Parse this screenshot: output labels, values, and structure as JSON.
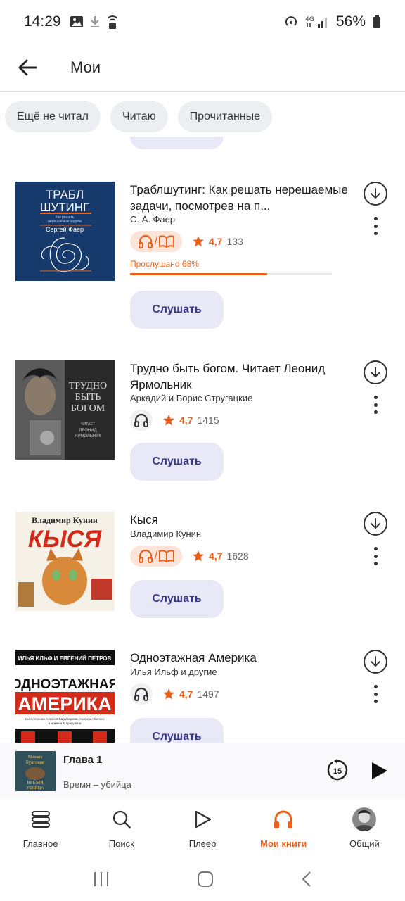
{
  "status_bar": {
    "time": "14:29",
    "battery": "56%"
  },
  "header": {
    "title": "Мои"
  },
  "filters": [
    "Ещё не читал",
    "Читаю",
    "Прочитанные"
  ],
  "listen_label": "Слушать",
  "books": [
    {
      "title": "Траблшутинг: Как решать нерешаемые задачи, посмотрев на п...",
      "author": "С. А. Фаер",
      "format": "audio+text",
      "rating": "4,7",
      "ratings_count": "133",
      "progress_label": "Прослушано 68%",
      "progress": 0.68,
      "cover_text": [
        "ТРАБЛ",
        "ШУТИНГ",
        "Как решать",
        "нерешаемые задачи",
        "Сергей Фаер"
      ]
    },
    {
      "title": "Трудно быть богом. Читает Леонид Ярмольник",
      "author": "Аркадий и Борис Стругацкие",
      "format": "audio",
      "rating": "4,7",
      "ratings_count": "1415",
      "cover_text": [
        "ТРУДНО",
        "БЫТЬ",
        "БОГОМ",
        "ЧИТАЕТ",
        "ЛЕОНИД",
        "ЯРМОЛЬНИК"
      ]
    },
    {
      "title": "Кыся",
      "author": "Владимир Кунин",
      "format": "audio+text",
      "rating": "4,7",
      "ratings_count": "1628",
      "cover_text": [
        "Владимир Кунин",
        "КЫСЯ"
      ]
    },
    {
      "title": "Одноэтажная Америка",
      "author": "Илья Ильф и другие",
      "format": "audio",
      "rating": "4,7",
      "ratings_count": "1497",
      "cover_text": [
        "ИЛЬЯ ИЛЬФ И ЕВГЕНИЙ ПЕТРОВ",
        "ОДНОЭТАЖНАЯ",
        "АМЕРИКА",
        "в исполнении Алексея Багдасарова, Анатолия Белого",
        "и Армена Марахуляна"
      ]
    }
  ],
  "mini_player": {
    "title": "Глава 1",
    "subtitle": "Время – убийца",
    "skip_seconds": "15",
    "cover_text": [
      "Михаил",
      "Булгаков",
      "ВРЕМЯ",
      "УБИЙЦА"
    ]
  },
  "nav": [
    {
      "label": "Главное",
      "icon": "stack-icon"
    },
    {
      "label": "Поиск",
      "icon": "search-icon"
    },
    {
      "label": "Плеер",
      "icon": "play-outline-icon"
    },
    {
      "label": "Мои книги",
      "icon": "headphones-icon",
      "active": true
    },
    {
      "label": "Общий",
      "icon": "avatar"
    }
  ],
  "colors": {
    "accent": "#e8601c",
    "listen_bg": "#e9e8f7",
    "listen_text": "#3a3a8c"
  }
}
